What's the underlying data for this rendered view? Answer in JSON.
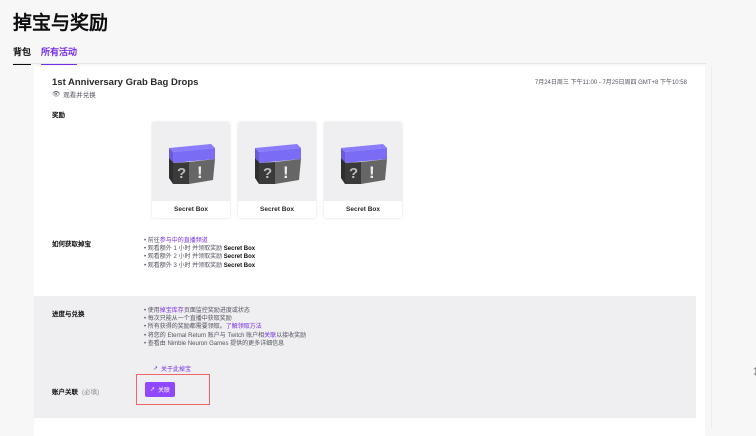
{
  "page_title": "掉宝与奖励",
  "tabs": [
    {
      "label": "背包"
    },
    {
      "label": "所有活动"
    }
  ],
  "event": {
    "name": "1st Anniversary Grab Bag Drops",
    "watch_label": "观看并兑换",
    "date_range": "7月24日周三 下午11:00 - 7月25日周四 GMT+8 下午10:58",
    "rewards_label": "奖励",
    "rewards": [
      {
        "name": "Secret Box"
      },
      {
        "name": "Secret Box"
      },
      {
        "name": "Secret Box"
      }
    ],
    "how_label": "如何获取掉宝",
    "how": {
      "go_prefix": "前往",
      "go_link": "参与中的直播频道",
      "steps": [
        {
          "text": "观看额外 1 小时 并领取奖励 ",
          "item": "Secret Box"
        },
        {
          "text": "观看额外 2 小时 并领取奖励 ",
          "item": "Secret Box"
        },
        {
          "text": "观看额外 3 小时 并领取奖励 ",
          "item": "Secret Box"
        }
      ]
    },
    "progress_label": "进度与兑换",
    "progress": {
      "l1_pre": "使用",
      "l1_link": "掉宝库存",
      "l1_post": "页面监控奖励进度或状态",
      "l2": "每次只能从一个直播中获取奖励",
      "l3_pre": "所有获得的奖励都需要领取。",
      "l3_link": "了解领取方法",
      "l4_pre": "将您的 Eternal Return 账户与 Twitch 账户相",
      "l4_link": "关联",
      "l4_post": "以接收奖励",
      "l5": "查看由 Nimble Neuron Games 提供的更多详细信息"
    },
    "about_link": "关于此掉宝",
    "account_label": "账户关联",
    "account_required": "(必填)",
    "connect_button": "关联"
  }
}
